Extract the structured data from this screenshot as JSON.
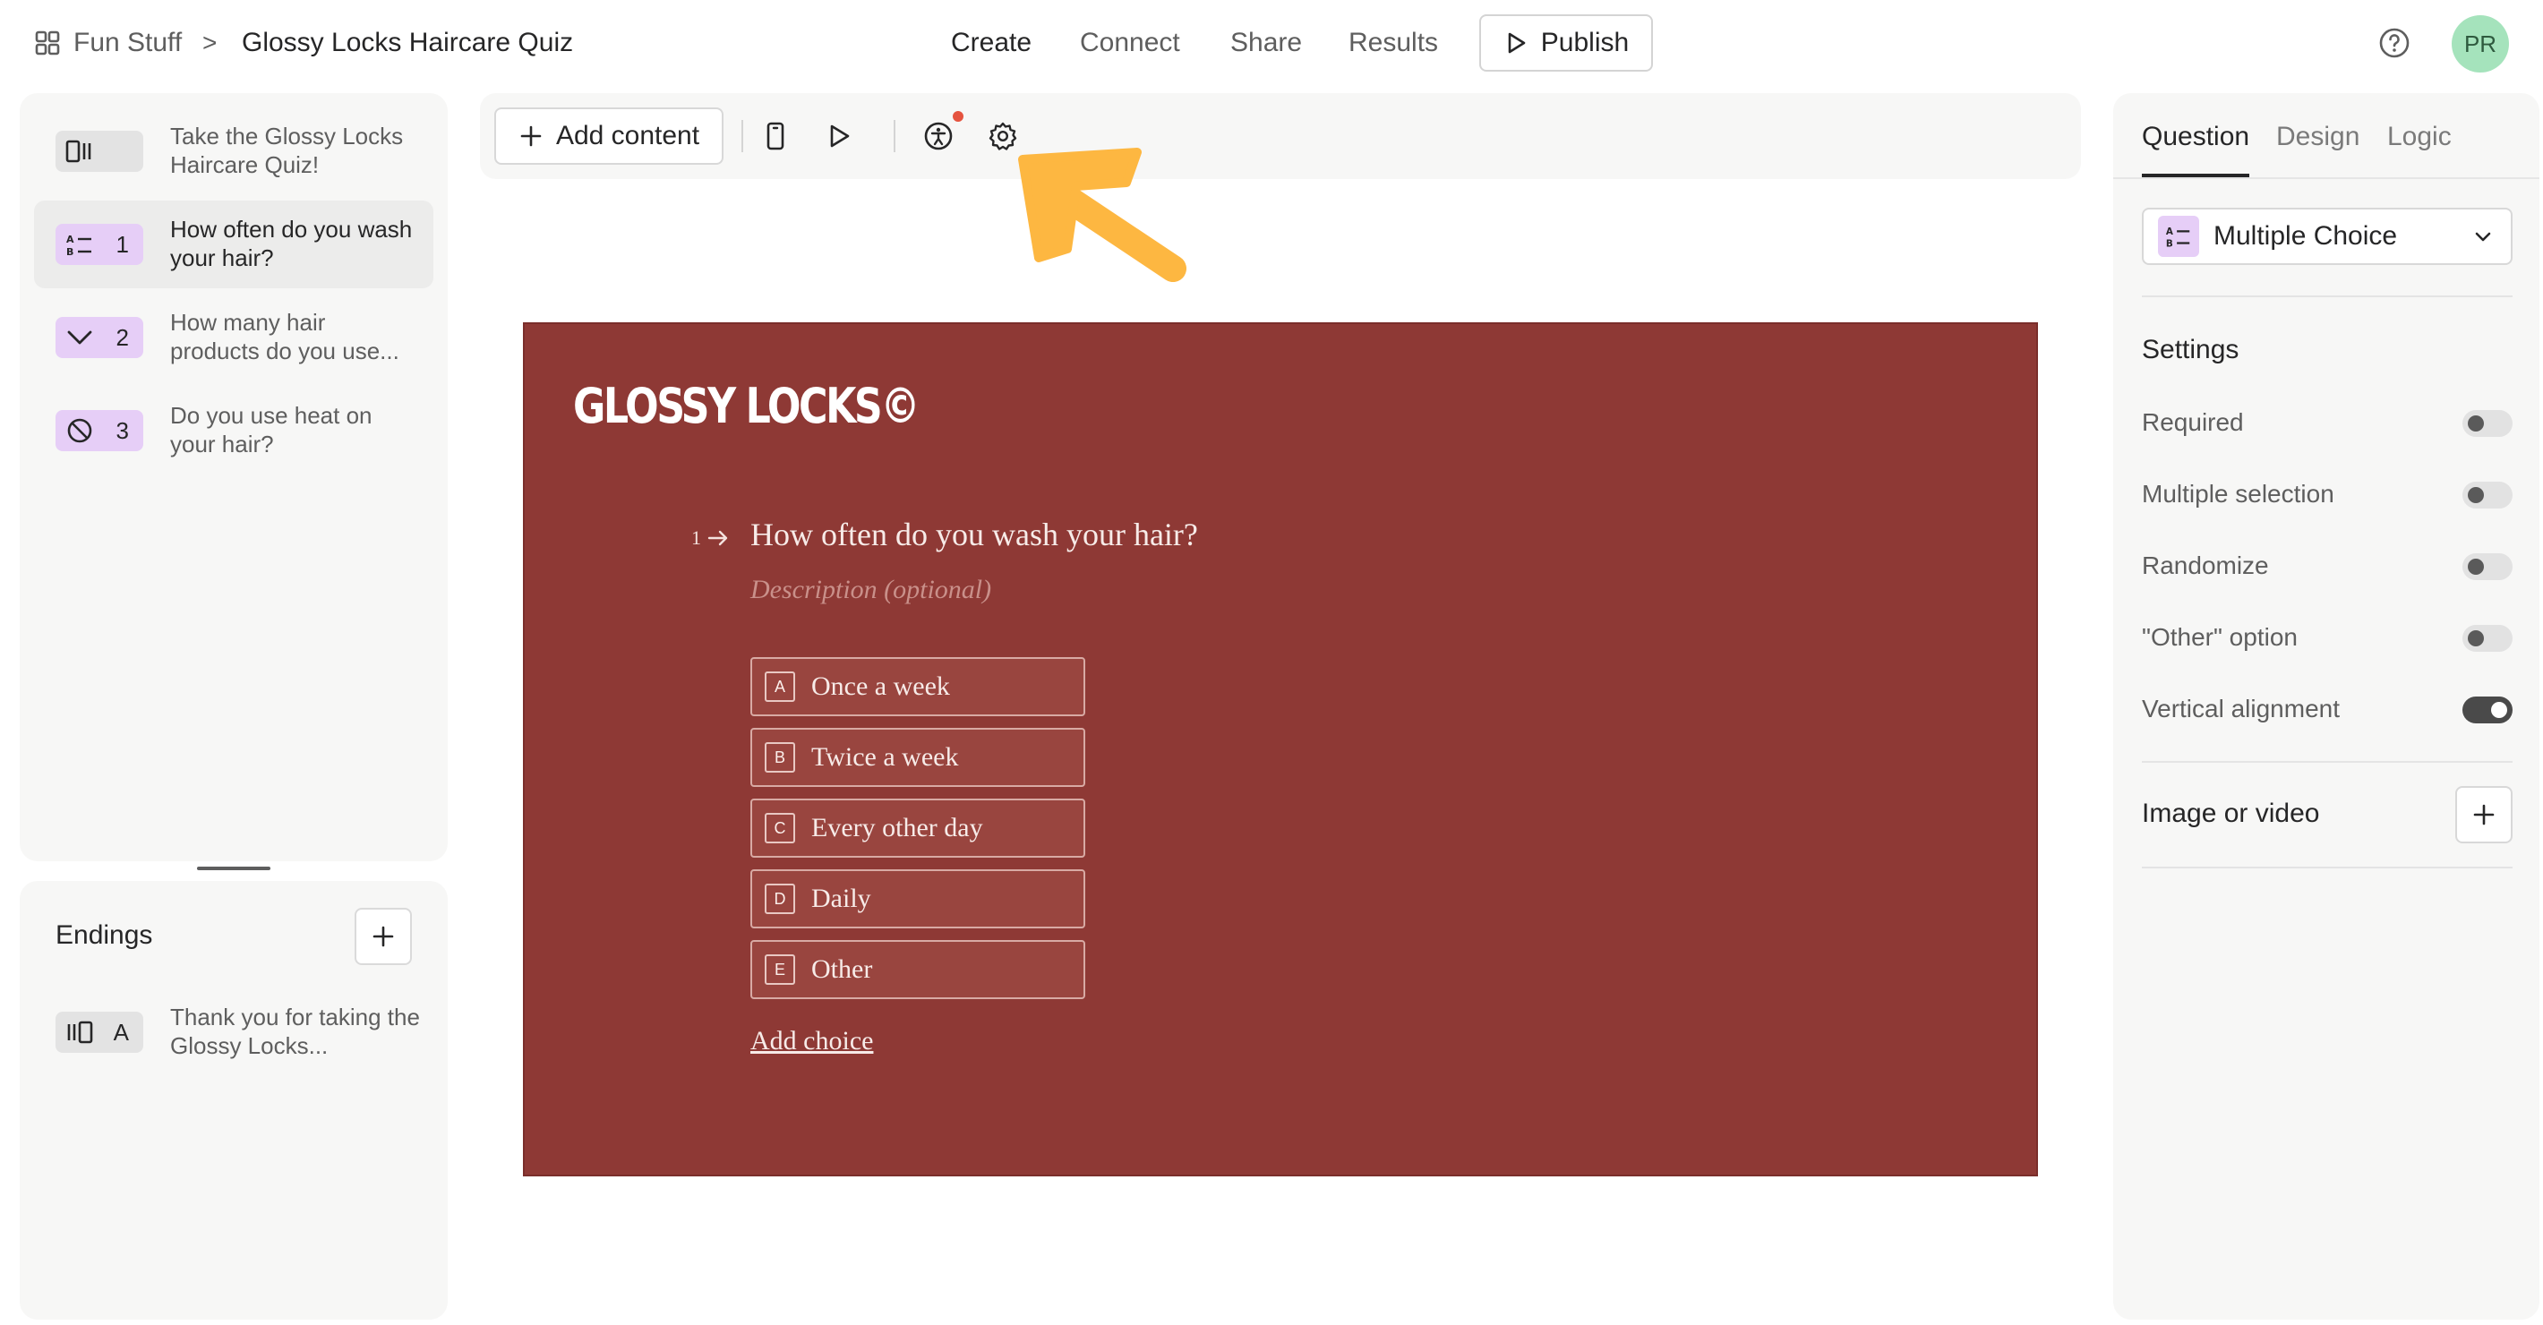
{
  "header": {
    "workspace": "Fun Stuff",
    "separator": ">",
    "form_title": "Glossy Locks Haircare Quiz",
    "nav": [
      "Create",
      "Connect",
      "Share",
      "Results"
    ],
    "publish_label": "Publish",
    "avatar_initials": "PR"
  },
  "sidebar": {
    "items": [
      {
        "number": "",
        "text": "Take the Glossy Locks Haircare Quiz!"
      },
      {
        "number": "1",
        "text": "How often do you wash your hair?"
      },
      {
        "number": "2",
        "text": "How many hair products do you use..."
      },
      {
        "number": "3",
        "text": "Do you use heat on your hair?"
      }
    ],
    "endings_title": "Endings",
    "endings": [
      {
        "number": "A",
        "text": "Thank you for taking the Glossy Locks..."
      }
    ]
  },
  "toolbar": {
    "add_content_label": "Add content"
  },
  "canvas": {
    "brand": "GLOSSY LOCKS©",
    "question_number": "1",
    "question_title": "How often do you wash your hair?",
    "description_placeholder": "Description (optional)",
    "choices": [
      {
        "key": "A",
        "label": "Once a week"
      },
      {
        "key": "B",
        "label": "Twice a week"
      },
      {
        "key": "C",
        "label": "Every other day"
      },
      {
        "key": "D",
        "label": "Daily"
      },
      {
        "key": "E",
        "label": "Other"
      }
    ],
    "add_choice_label": "Add choice",
    "background_color": "#8e3935"
  },
  "right_panel": {
    "tabs": [
      "Question",
      "Design",
      "Logic"
    ],
    "question_type": "Multiple Choice",
    "settings_title": "Settings",
    "settings": [
      {
        "label": "Required",
        "on": false
      },
      {
        "label": "Multiple selection",
        "on": false
      },
      {
        "label": "Randomize",
        "on": false
      },
      {
        "label": "\"Other\" option",
        "on": false
      },
      {
        "label": "Vertical alignment",
        "on": true
      }
    ],
    "media_label": "Image or video"
  },
  "colors": {
    "accent_purple": "#e6cef7",
    "annotation_arrow": "#fdb741",
    "notification_dot": "#e5533f"
  }
}
